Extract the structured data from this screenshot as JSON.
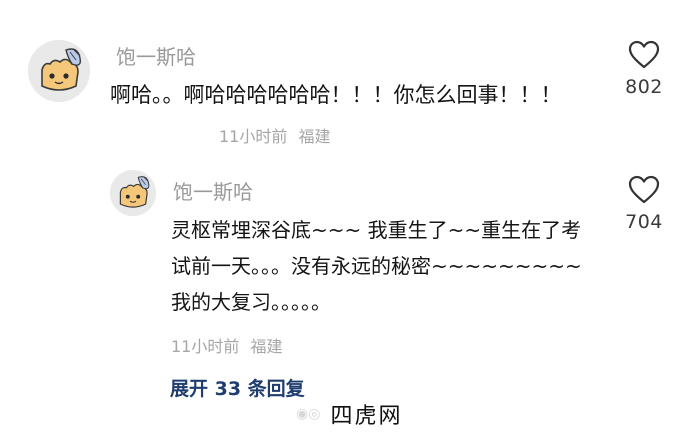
{
  "comments": [
    {
      "username": "饱一斯哈",
      "text": "啊哈。。啊哈哈哈哈哈哈！！！你怎么回事！！！",
      "time": "11小时前",
      "location": "福建",
      "likes": "802",
      "avatar_icon": "cartoon-avatar-icon"
    }
  ],
  "reply": {
    "username": "饱一斯哈",
    "text": "灵枢常埋深谷底~~~ 我重生了~~重生在了考试前一天。。。没有永远的秘密~~~~~~~~~ 我的大复习。。。。。",
    "time": "11小时前",
    "location": "福建",
    "likes": "704",
    "avatar_icon": "cartoon-avatar-icon"
  },
  "expand_replies": "展开 33 条回复",
  "watermark": "四虎网",
  "colors": {
    "username": "#9a9a9a",
    "meta": "#a6a6a6",
    "expand_link": "#1f3d6e",
    "heart_outline": "#333333"
  },
  "icons": {
    "like": "heart-outline-icon"
  }
}
